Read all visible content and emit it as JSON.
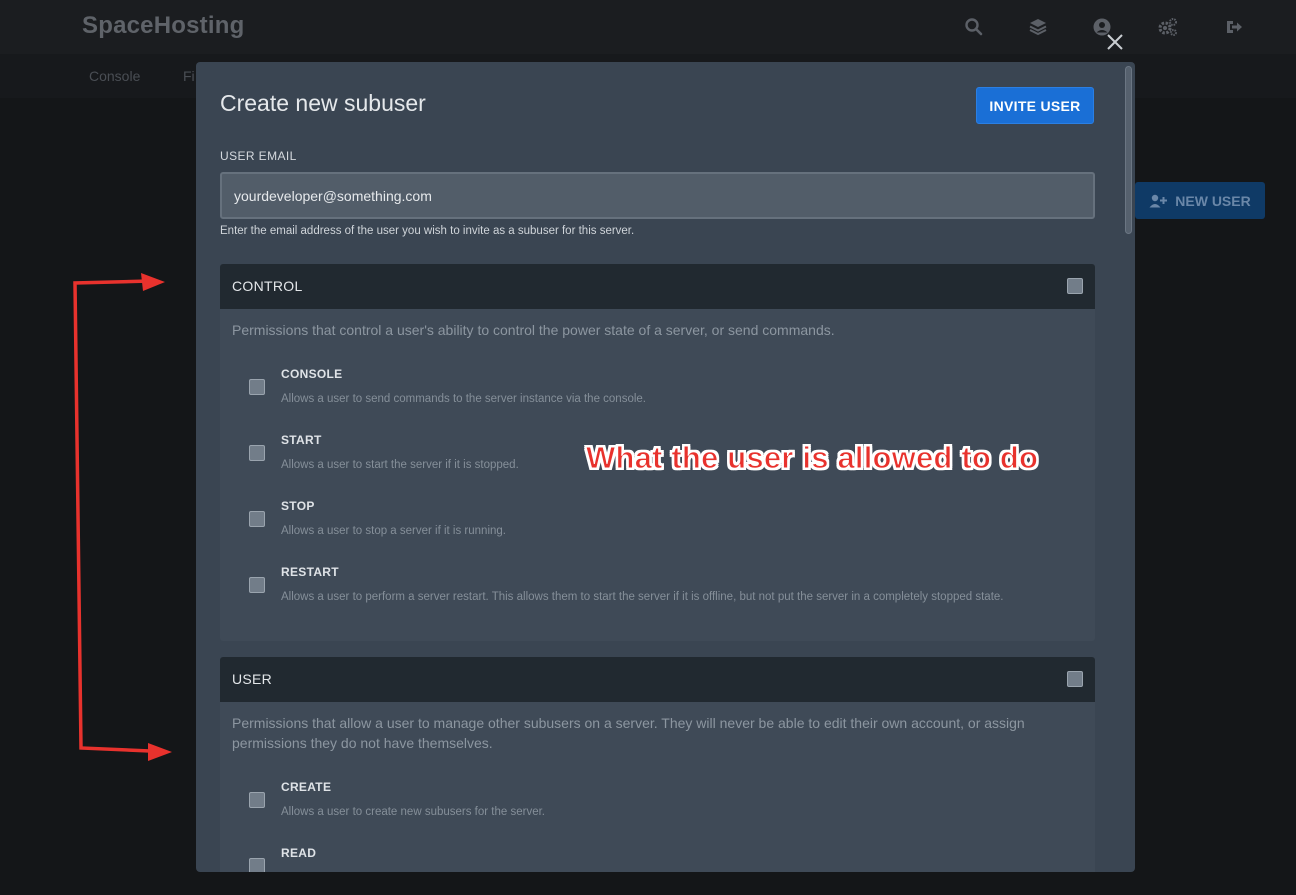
{
  "app": {
    "brand": "SpaceHosting",
    "top_icons": [
      "search-icon",
      "layers-icon",
      "user-circle-icon",
      "cogs-icon",
      "sign-out-icon"
    ],
    "subnav": [
      "Console",
      "Fi"
    ],
    "new_user_label": "NEW USER"
  },
  "modal": {
    "title": "Create new subuser",
    "invite_label": "INVITE USER",
    "email_label": "USER EMAIL",
    "email_value": "yourdeveloper@something.com",
    "email_help": "Enter the email address of the user you wish to invite as a subuser for this server.",
    "groups": [
      {
        "title": "CONTROL",
        "description": "Permissions that control a user's ability to control the power state of a server, or send commands.",
        "items": [
          {
            "title": "CONSOLE",
            "description": "Allows a user to send commands to the server instance via the console."
          },
          {
            "title": "START",
            "description": "Allows a user to start the server if it is stopped."
          },
          {
            "title": "STOP",
            "description": "Allows a user to stop a server if it is running."
          },
          {
            "title": "RESTART",
            "description": "Allows a user to perform a server restart. This allows them to start the server if it is offline, but not put the server in a completely stopped state."
          }
        ]
      },
      {
        "title": "USER",
        "description": "Permissions that allow a user to manage other subusers on a server. They will never be able to edit their own account, or assign permissions they do not have themselves.",
        "items": [
          {
            "title": "CREATE",
            "description": "Allows a user to create new subusers for the server."
          },
          {
            "title": "READ",
            "description": ""
          }
        ]
      }
    ]
  },
  "annotation": {
    "text": "What the user is allowed to do",
    "color": "#e8322d"
  },
  "colors": {
    "accent": "#1a6fd6",
    "modal_bg": "#3a4552",
    "page_bg": "#141618"
  }
}
